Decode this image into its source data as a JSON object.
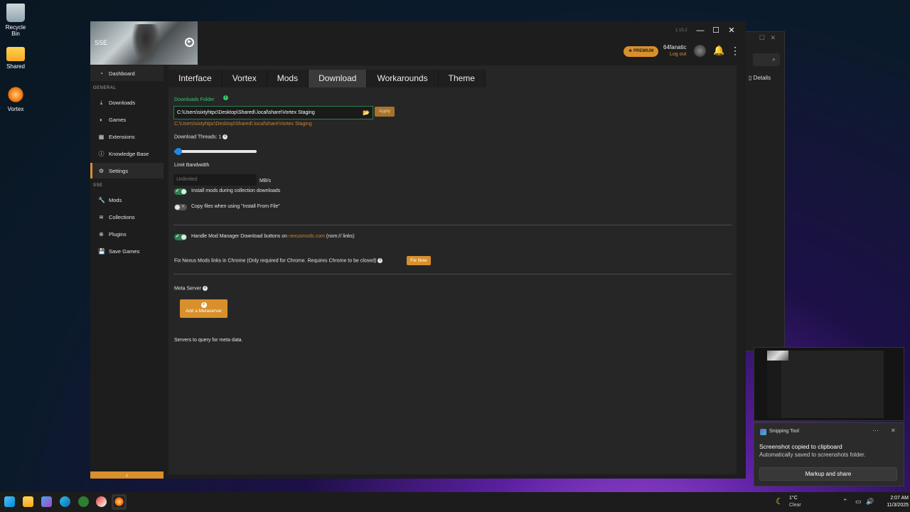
{
  "desktop": {
    "icons": [
      {
        "label": "Recycle Bin",
        "icon": "recycle-bin-icon"
      },
      {
        "label": "Shared",
        "icon": "folder-icon"
      },
      {
        "label": "Vortex",
        "icon": "vortex-icon"
      }
    ]
  },
  "background_window": {
    "details_label": "Details"
  },
  "window": {
    "game_label": "SSE",
    "version": "1.15.2",
    "premium_label": "★ PREMIUM",
    "username": "64fanatic",
    "logout_label": "Log out"
  },
  "sidebar": {
    "dashboard_label": "Dashboard",
    "section_general": "GENERAL",
    "general_items": [
      {
        "label": "Downloads",
        "icon": "download-icon"
      },
      {
        "label": "Games",
        "icon": "gamepad-icon"
      },
      {
        "label": "Extensions",
        "icon": "extensions-icon"
      },
      {
        "label": "Knowledge Base",
        "icon": "info-icon"
      },
      {
        "label": "Settings",
        "icon": "gear-icon",
        "active": true
      }
    ],
    "section_sse": "SSE",
    "sse_items": [
      {
        "label": "Mods",
        "icon": "wrench-icon"
      },
      {
        "label": "Collections",
        "icon": "layers-icon"
      },
      {
        "label": "Plugins",
        "icon": "plus-circle-icon"
      },
      {
        "label": "Save Games",
        "icon": "save-icon"
      }
    ]
  },
  "tabs": [
    {
      "label": "Interface"
    },
    {
      "label": "Vortex"
    },
    {
      "label": "Mods"
    },
    {
      "label": "Download",
      "active": true
    },
    {
      "label": "Workarounds"
    },
    {
      "label": "Theme"
    }
  ],
  "download": {
    "folder_label": "Downloads Folder",
    "folder_value": "C:\\Users\\sixtyhtpc\\Desktop\\Shared\\.local\\share\\Vortex Staging",
    "apply_label": "Apply",
    "folder_hint": "C:\\Users\\sixtyhtpc\\Desktop\\Shared\\.local\\share\\Vortex Staging",
    "threads_label": "Download Threads: 1",
    "threads_value": 1,
    "bandwidth_label": "Limit Bandwidth",
    "bandwidth_placeholder": "Unlimited",
    "bandwidth_unit": "MB/s",
    "opt_install_mods": "Install mods during collection downloads",
    "opt_install_mods_on": true,
    "opt_copy_files": "Copy files when using \"Install From File\"",
    "opt_copy_files_on": false,
    "handle_prefix": "Handle Mod Manager Download buttons on ",
    "handle_link": "nexusmods.com",
    "handle_suffix": " (nxm:// links)",
    "handle_on": true,
    "fix_text": "Fix Nexus Mods links in Chrome (Only required for Chrome. Requires Chrome to be closed)",
    "fix_button": "Fix Now",
    "meta_label": "Meta Server",
    "meta_button": "Add a Metaserver",
    "servers_text": "Servers to query for meta data."
  },
  "toast": {
    "app_name": "Snipping Tool",
    "title": "Screenshot copied to clipboard",
    "body": "Automatically saved to screenshots folder.",
    "button": "Markup and share"
  },
  "taskbar": {
    "temperature": "1°C",
    "condition": "Clear",
    "time": "2:07 AM",
    "date": "11/3/2025"
  },
  "colors": {
    "accent": "#d98f2b",
    "success": "#35c76c",
    "slider": "#1e88e5"
  }
}
